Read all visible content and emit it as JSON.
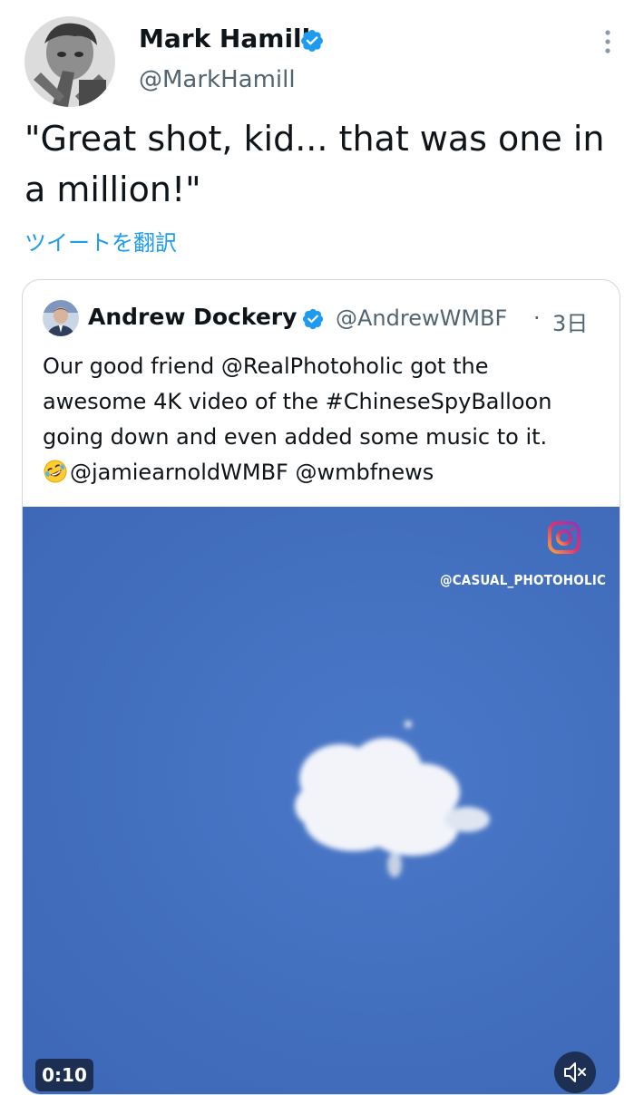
{
  "tweet": {
    "author": {
      "name": "Mark Hamill",
      "handle": "@MarkHamill",
      "verified": true
    },
    "text": "\"Great shot, kid... that was one in a million!\"",
    "translate_label": "ツイートを翻訳"
  },
  "quoted_tweet": {
    "author": {
      "name": "Andrew Dockery",
      "handle": "@AndrewWMBF",
      "verified": true
    },
    "separator": "·",
    "time": "3日",
    "text_lines": [
      "Our good friend @RealPhotoholic got the",
      "awesome 4K video of the #ChineseSpyBalloon",
      "going down and even added some music to it."
    ],
    "last_line_emoji": "rolling-on-floor-laughing-emoji",
    "last_line_text": "@jamiearnoldWMBF @wmbfnews",
    "media": {
      "type": "video",
      "watermark": "@CASUAL_PHOTOHOLIC",
      "duration": "0:10",
      "muted": true
    }
  },
  "colors": {
    "link": "#1d9bf0",
    "verified": "#1d9bf0",
    "secondary_text": "#536471",
    "primary_text": "#0f1419",
    "border": "#cfd9de",
    "sky": "#4470c0"
  },
  "icons": {
    "verified": "verified-badge-icon",
    "more": "more-vertical-icon",
    "instagram": "instagram-icon",
    "mute": "volume-muted-icon"
  }
}
